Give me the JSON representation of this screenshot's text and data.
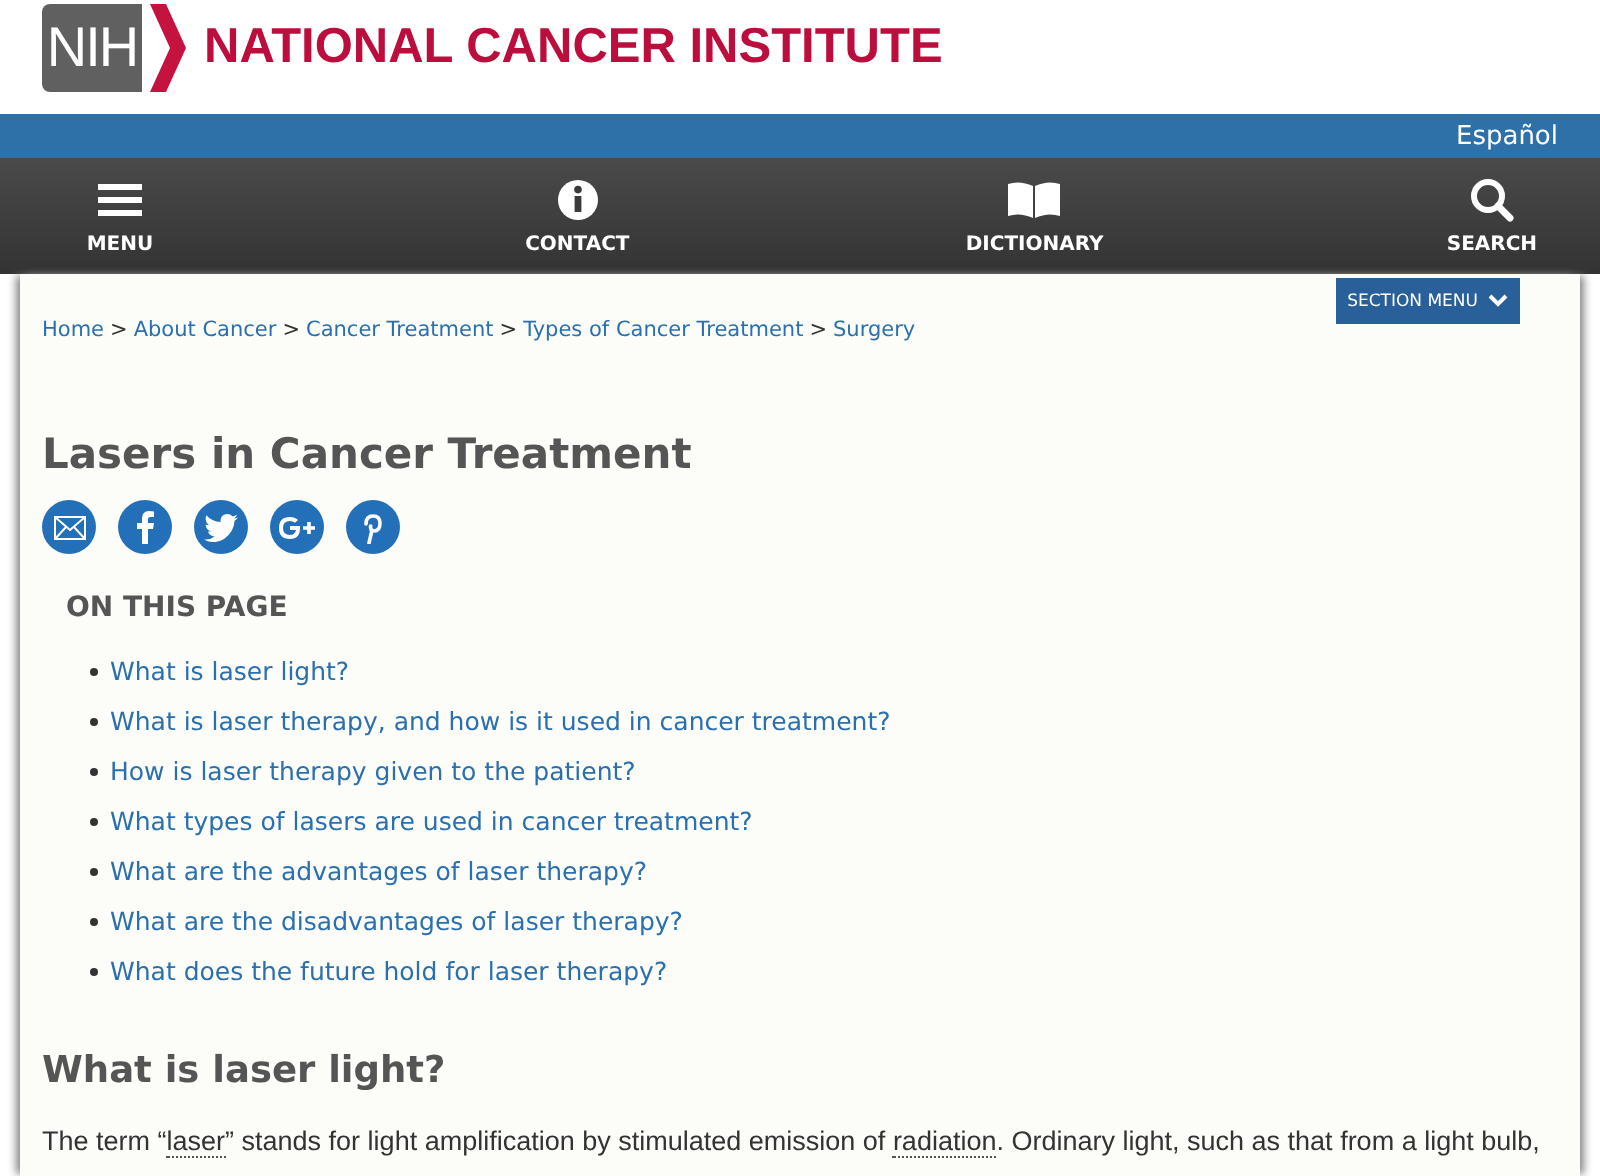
{
  "header": {
    "logo_badge": "NIH",
    "title": "NATIONAL CANCER INSTITUTE"
  },
  "language_link": "Español",
  "nav": [
    {
      "kind": "menu",
      "label": "MENU"
    },
    {
      "kind": "contact",
      "label": "CONTACT"
    },
    {
      "kind": "dictionary",
      "label": "DICTIONARY"
    },
    {
      "kind": "search",
      "label": "SEARCH"
    }
  ],
  "section_menu": "SECTION MENU",
  "breadcrumb": [
    "Home",
    "About Cancer",
    "Cancer Treatment",
    "Types of Cancer Treatment",
    "Surgery"
  ],
  "breadcrumb_separator": ">",
  "title": "Lasers in Cancer Treatment",
  "share": [
    {
      "kind": "email"
    },
    {
      "kind": "facebook"
    },
    {
      "kind": "twitter"
    },
    {
      "kind": "googleplus"
    },
    {
      "kind": "pinterest"
    }
  ],
  "on_this_page": {
    "heading": "ON THIS PAGE",
    "items": [
      "What is laser light?",
      "What is laser therapy, and how is it used in cancer treatment?",
      "How is laser therapy given to the patient?",
      "What types of lasers are used in cancer treatment?",
      "What are the advantages of laser therapy?",
      "What are the disadvantages of laser therapy?",
      "What does the future hold for laser therapy?"
    ]
  },
  "section": {
    "heading": "What is laser light?",
    "paragraph": [
      {
        "kind": "text",
        "text": "The term “"
      },
      {
        "kind": "term",
        "text": "laser"
      },
      {
        "kind": "text",
        "text": "” stands for light amplification by stimulated emission of "
      },
      {
        "kind": "term",
        "text": "radiation"
      },
      {
        "kind": "text",
        "text": ". Ordinary light, such as that from a light bulb,"
      }
    ]
  }
}
